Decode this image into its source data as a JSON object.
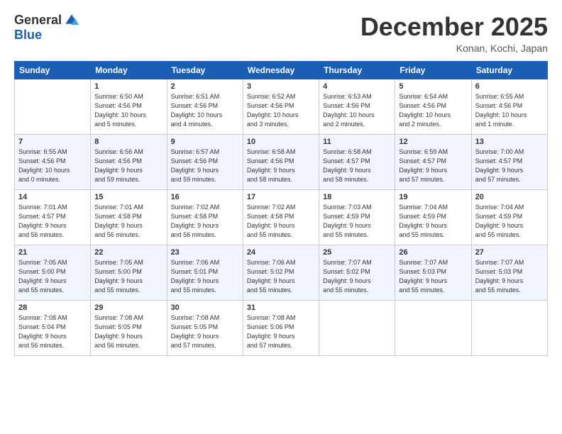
{
  "logo": {
    "general": "General",
    "blue": "Blue"
  },
  "header": {
    "month": "December 2025",
    "location": "Konan, Kochi, Japan"
  },
  "days_of_week": [
    "Sunday",
    "Monday",
    "Tuesday",
    "Wednesday",
    "Thursday",
    "Friday",
    "Saturday"
  ],
  "weeks": [
    [
      {
        "day": "",
        "info": ""
      },
      {
        "day": "1",
        "info": "Sunrise: 6:50 AM\nSunset: 4:56 PM\nDaylight: 10 hours\nand 5 minutes."
      },
      {
        "day": "2",
        "info": "Sunrise: 6:51 AM\nSunset: 4:56 PM\nDaylight: 10 hours\nand 4 minutes."
      },
      {
        "day": "3",
        "info": "Sunrise: 6:52 AM\nSunset: 4:56 PM\nDaylight: 10 hours\nand 3 minutes."
      },
      {
        "day": "4",
        "info": "Sunrise: 6:53 AM\nSunset: 4:56 PM\nDaylight: 10 hours\nand 2 minutes."
      },
      {
        "day": "5",
        "info": "Sunrise: 6:54 AM\nSunset: 4:56 PM\nDaylight: 10 hours\nand 2 minutes."
      },
      {
        "day": "6",
        "info": "Sunrise: 6:55 AM\nSunset: 4:56 PM\nDaylight: 10 hours\nand 1 minute."
      }
    ],
    [
      {
        "day": "7",
        "info": "Sunrise: 6:55 AM\nSunset: 4:56 PM\nDaylight: 10 hours\nand 0 minutes."
      },
      {
        "day": "8",
        "info": "Sunrise: 6:56 AM\nSunset: 4:56 PM\nDaylight: 9 hours\nand 59 minutes."
      },
      {
        "day": "9",
        "info": "Sunrise: 6:57 AM\nSunset: 4:56 PM\nDaylight: 9 hours\nand 59 minutes."
      },
      {
        "day": "10",
        "info": "Sunrise: 6:58 AM\nSunset: 4:56 PM\nDaylight: 9 hours\nand 58 minutes."
      },
      {
        "day": "11",
        "info": "Sunrise: 6:58 AM\nSunset: 4:57 PM\nDaylight: 9 hours\nand 58 minutes."
      },
      {
        "day": "12",
        "info": "Sunrise: 6:59 AM\nSunset: 4:57 PM\nDaylight: 9 hours\nand 57 minutes."
      },
      {
        "day": "13",
        "info": "Sunrise: 7:00 AM\nSunset: 4:57 PM\nDaylight: 9 hours\nand 57 minutes."
      }
    ],
    [
      {
        "day": "14",
        "info": "Sunrise: 7:01 AM\nSunset: 4:57 PM\nDaylight: 9 hours\nand 56 minutes."
      },
      {
        "day": "15",
        "info": "Sunrise: 7:01 AM\nSunset: 4:58 PM\nDaylight: 9 hours\nand 56 minutes."
      },
      {
        "day": "16",
        "info": "Sunrise: 7:02 AM\nSunset: 4:58 PM\nDaylight: 9 hours\nand 56 minutes."
      },
      {
        "day": "17",
        "info": "Sunrise: 7:02 AM\nSunset: 4:58 PM\nDaylight: 9 hours\nand 55 minutes."
      },
      {
        "day": "18",
        "info": "Sunrise: 7:03 AM\nSunset: 4:59 PM\nDaylight: 9 hours\nand 55 minutes."
      },
      {
        "day": "19",
        "info": "Sunrise: 7:04 AM\nSunset: 4:59 PM\nDaylight: 9 hours\nand 55 minutes."
      },
      {
        "day": "20",
        "info": "Sunrise: 7:04 AM\nSunset: 4:59 PM\nDaylight: 9 hours\nand 55 minutes."
      }
    ],
    [
      {
        "day": "21",
        "info": "Sunrise: 7:05 AM\nSunset: 5:00 PM\nDaylight: 9 hours\nand 55 minutes."
      },
      {
        "day": "22",
        "info": "Sunrise: 7:05 AM\nSunset: 5:00 PM\nDaylight: 9 hours\nand 55 minutes."
      },
      {
        "day": "23",
        "info": "Sunrise: 7:06 AM\nSunset: 5:01 PM\nDaylight: 9 hours\nand 55 minutes."
      },
      {
        "day": "24",
        "info": "Sunrise: 7:06 AM\nSunset: 5:02 PM\nDaylight: 9 hours\nand 55 minutes."
      },
      {
        "day": "25",
        "info": "Sunrise: 7:07 AM\nSunset: 5:02 PM\nDaylight: 9 hours\nand 55 minutes."
      },
      {
        "day": "26",
        "info": "Sunrise: 7:07 AM\nSunset: 5:03 PM\nDaylight: 9 hours\nand 55 minutes."
      },
      {
        "day": "27",
        "info": "Sunrise: 7:07 AM\nSunset: 5:03 PM\nDaylight: 9 hours\nand 55 minutes."
      }
    ],
    [
      {
        "day": "28",
        "info": "Sunrise: 7:08 AM\nSunset: 5:04 PM\nDaylight: 9 hours\nand 56 minutes."
      },
      {
        "day": "29",
        "info": "Sunrise: 7:08 AM\nSunset: 5:05 PM\nDaylight: 9 hours\nand 56 minutes."
      },
      {
        "day": "30",
        "info": "Sunrise: 7:08 AM\nSunset: 5:05 PM\nDaylight: 9 hours\nand 57 minutes."
      },
      {
        "day": "31",
        "info": "Sunrise: 7:08 AM\nSunset: 5:06 PM\nDaylight: 9 hours\nand 57 minutes."
      },
      {
        "day": "",
        "info": ""
      },
      {
        "day": "",
        "info": ""
      },
      {
        "day": "",
        "info": ""
      }
    ]
  ]
}
